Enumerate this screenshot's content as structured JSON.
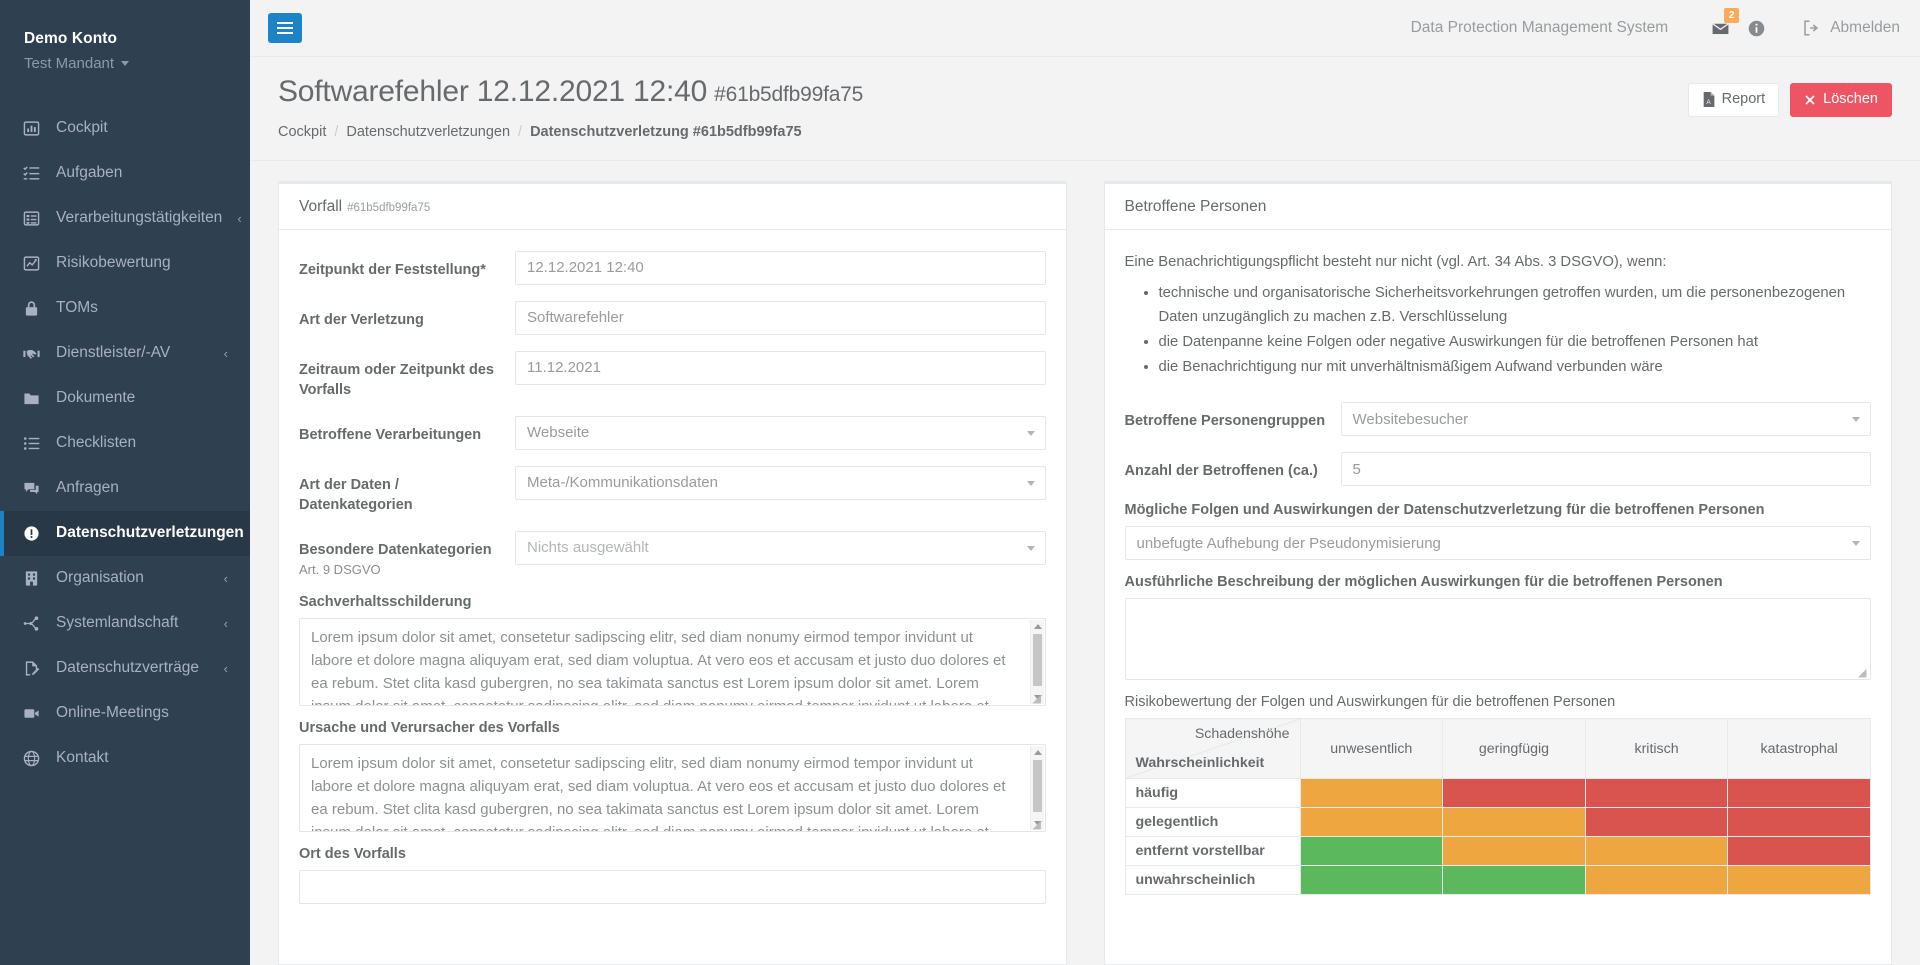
{
  "sidebar": {
    "brand": {
      "name": "Demo Konto",
      "tenant": "Test Mandant"
    },
    "items": [
      {
        "label": "Cockpit",
        "icon": "chart-bar-icon",
        "chevron": "",
        "active": false
      },
      {
        "label": "Aufgaben",
        "icon": "tasks-icon",
        "chevron": "",
        "active": false
      },
      {
        "label": "Verarbeitungstätigkeiten",
        "icon": "table-list-icon",
        "chevron": "‹",
        "active": false
      },
      {
        "label": "Risikobewertung",
        "icon": "chart-line-icon",
        "chevron": "",
        "active": false
      },
      {
        "label": "TOMs",
        "icon": "lock-icon",
        "chevron": "",
        "active": false
      },
      {
        "label": "Dienstleister/-AV",
        "icon": "handshake-icon",
        "chevron": "‹",
        "active": false
      },
      {
        "label": "Dokumente",
        "icon": "folder-icon",
        "chevron": "",
        "active": false
      },
      {
        "label": "Checklisten",
        "icon": "list-icon",
        "chevron": "",
        "active": false
      },
      {
        "label": "Anfragen",
        "icon": "comments-icon",
        "chevron": "",
        "active": false
      },
      {
        "label": "Datenschutzverletzungen",
        "icon": "exclamation-circle-icon",
        "chevron": "",
        "active": true
      },
      {
        "label": "Organisation",
        "icon": "building-icon",
        "chevron": "‹",
        "active": false
      },
      {
        "label": "Systemlandschaft",
        "icon": "network-icon",
        "chevron": "‹",
        "active": false
      },
      {
        "label": "Datenschutzverträge",
        "icon": "file-signature-icon",
        "chevron": "‹",
        "active": false
      },
      {
        "label": "Online-Meetings",
        "icon": "video-icon",
        "chevron": "",
        "active": false
      },
      {
        "label": "Kontakt",
        "icon": "globe-icon",
        "chevron": "",
        "active": false
      }
    ]
  },
  "topbar": {
    "app_name": "Data Protection Management System",
    "mail_badge": "2",
    "logout_label": "Abmelden"
  },
  "page": {
    "title": "Softwarefehler 12.12.2021 12:40",
    "title_hash": "#61b5dfb99fa75",
    "breadcrumb": {
      "item1": "Cockpit",
      "item2": "Datenschutzverletzungen",
      "current": "Datenschutzverletzung #61b5dfb99fa75",
      "separator": "/"
    },
    "actions": {
      "report_label": "Report",
      "delete_label": "Löschen"
    }
  },
  "left_panel": {
    "title": "Vorfall",
    "title_id": "#61b5dfb99fa75",
    "fields": [
      {
        "label": "Zeitpunkt der Feststellung*",
        "value": "12.12.2021 12:40",
        "type": "input"
      },
      {
        "label": "Art der Verletzung",
        "value": "Softwarefehler",
        "type": "input"
      },
      {
        "label": "Zeitraum oder Zeitpunkt des Vorfalls",
        "value": "11.12.2021",
        "type": "input"
      },
      {
        "label": "Betroffene Verarbeitungen",
        "value": "Webseite",
        "type": "select"
      },
      {
        "label": "Art der Daten / Datenkategorien",
        "value": "Meta-/Kommunikationsdaten",
        "type": "select"
      },
      {
        "label": "Besondere Datenkategorien",
        "sublabel": "Art. 9 DSGVO",
        "value": "Nichts ausgewählt",
        "type": "select",
        "muted": true
      }
    ],
    "textareas": [
      {
        "label": "Sachverhaltsschilderung",
        "value": "Lorem ipsum dolor sit amet, consetetur sadipscing elitr, sed diam nonumy eirmod tempor invidunt ut labore et dolore magna aliquyam erat, sed diam voluptua. At vero eos et accusam et justo duo dolores et ea rebum. Stet clita kasd gubergren, no sea takimata sanctus est Lorem ipsum dolor sit amet. Lorem ipsum dolor sit amet, consetetur sadipscing elitr, sed diam nonumy eirmod tempor invidunt ut labore et dolore magna aliquyam erat, sed diam voluptua. At vero eos et accusam et justo duo dolores et ea rebum. Stet clita kasd gubergren, no sea takimata sanctus est Lorem ipsum dolor sit amet."
      },
      {
        "label": "Ursache und Verursacher des Vorfalls",
        "value": "Lorem ipsum dolor sit amet, consetetur sadipscing elitr, sed diam nonumy eirmod tempor invidunt ut labore et dolore magna aliquyam erat, sed diam voluptua. At vero eos et accusam et justo duo dolores et ea rebum. Stet clita kasd gubergren, no sea takimata sanctus est Lorem ipsum dolor sit amet. Lorem ipsum dolor sit amet, consetetur sadipscing elitr, sed diam nonumy eirmod tempor invidunt ut labore et dolore magna aliquyam erat, sed diam voluptua. At vero eos et accusam et justo duo dolores et ea rebum. Stet clita kasd gubergren, no sea takimata sanctus est Lorem ipsum dolor sit amet."
      }
    ],
    "location_label": "Ort des Vorfalls",
    "location_value": ""
  },
  "right_panel": {
    "title": "Betroffene Personen",
    "intro": "Eine Benachrichtigungspflicht besteht nur nicht (vgl. Art. 34 Abs. 3 DSGVO), wenn:",
    "bullets": [
      "technische und organisatorische Sicherheitsvorkehrungen getroffen wurden, um die personenbezogenen Daten unzugänglich zu machen z.B. Verschlüsselung",
      "die Datenpanne keine Folgen oder negative Auswirkungen für die betroffenen Personen hat",
      "die Benachrichtigung nur mit unverhältnismäßigem Aufwand verbunden wäre"
    ],
    "group_label": "Betroffene Personengruppen",
    "group_value": "Websitebesucher",
    "count_label": "Anzahl der Betroffenen (ca.)",
    "count_value": "5",
    "consequences_label": "Mögliche Folgen und Auswirkungen der Datenschutzverletzung für die betroffenen Personen",
    "consequences_value": "unbefugte Aufhebung der Pseudonymisierung",
    "description_label": "Ausführliche Beschreibung der möglichen Auswirkungen für die betroffenen Personen",
    "description_value": "",
    "matrix_label": "Risikobewertung der Folgen und Auswirkungen für die betroffenen Personen"
  },
  "chart_data": {
    "type": "heatmap",
    "title": "Risikobewertung der Folgen und Auswirkungen für die betroffenen Personen",
    "xlabel": "Schadenshöhe",
    "ylabel": "Wahrscheinlichkeit",
    "categories": [
      "unwesentlich",
      "geringfügig",
      "kritisch",
      "katastrophal"
    ],
    "rows": [
      "häufig",
      "gelegentlich",
      "entfernt vorstellbar",
      "unwahrscheinlich"
    ],
    "colors": {
      "green": "#5cb85c",
      "orange": "#eda640",
      "red": "#d9534f"
    },
    "values": [
      [
        "orange",
        "red",
        "red",
        "red"
      ],
      [
        "orange",
        "orange",
        "red",
        "red"
      ],
      [
        "green",
        "orange",
        "orange",
        "red"
      ],
      [
        "green",
        "green",
        "orange",
        "orange"
      ]
    ]
  }
}
